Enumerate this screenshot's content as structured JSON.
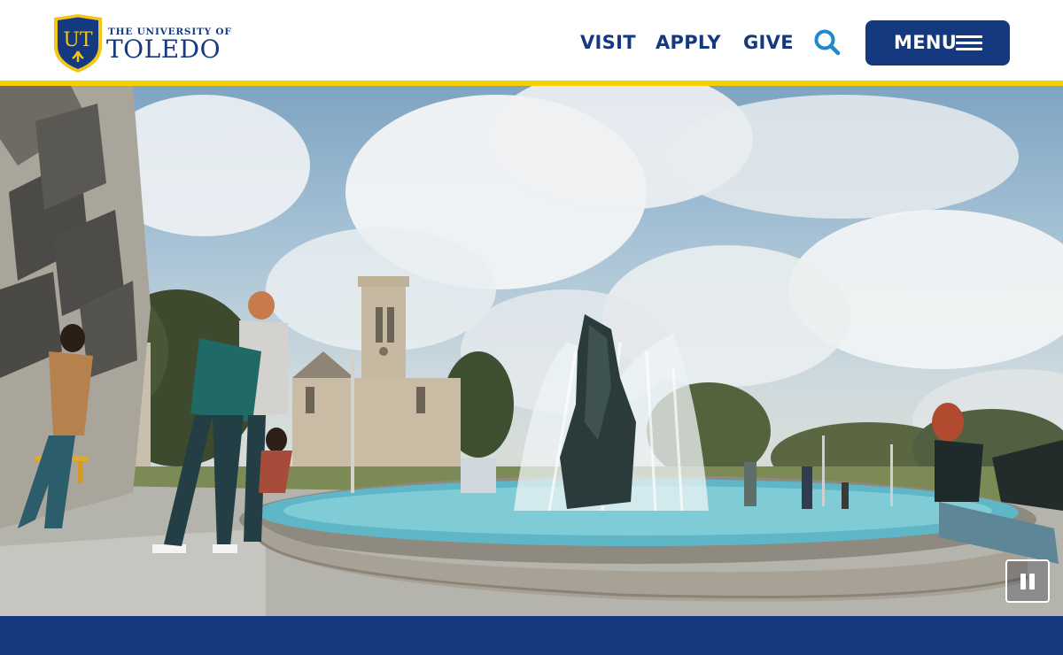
{
  "header": {
    "logo": {
      "monogram": "UT",
      "line1": "THE UNIVERSITY OF",
      "line2": "TOLEDO"
    },
    "nav": [
      {
        "label": "VISIT"
      },
      {
        "label": "APPLY"
      },
      {
        "label": "GIVE"
      }
    ],
    "search_icon": "search-icon",
    "menu_label": "MENU",
    "menu_icon": "hamburger-icon"
  },
  "hero": {
    "media": "campus fountain video",
    "control": "pause-icon"
  },
  "colors": {
    "brand_blue": "#15397f",
    "accent_gold": "#f5d000",
    "search_blue": "#1e88d3"
  }
}
